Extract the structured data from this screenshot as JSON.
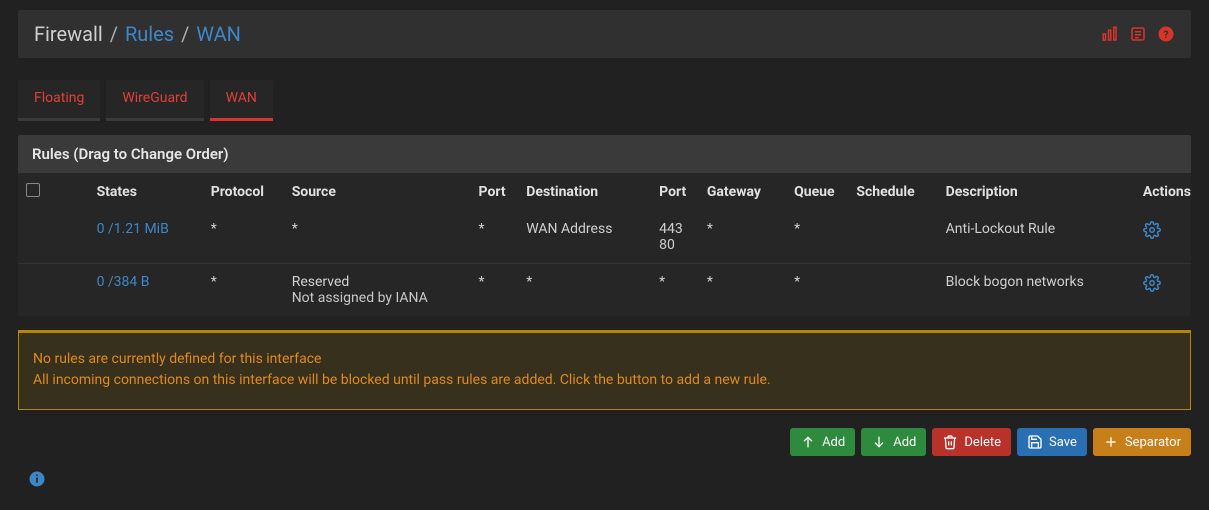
{
  "breadcrumb": {
    "root": "Firewall",
    "sep": "/",
    "mid": "Rules",
    "leaf": "WAN"
  },
  "header_icons": {
    "graph": "graph-icon",
    "log": "log-icon",
    "help": "help-icon"
  },
  "tabs": [
    {
      "label": "Floating",
      "active": false
    },
    {
      "label": "WireGuard",
      "active": false
    },
    {
      "label": "WAN",
      "active": true
    }
  ],
  "panel": {
    "title": "Rules (Drag to Change Order)"
  },
  "columns": {
    "states": "States",
    "protocol": "Protocol",
    "source": "Source",
    "sport": "Port",
    "destination": "Destination",
    "dport": "Port",
    "gateway": "Gateway",
    "queue": "Queue",
    "schedule": "Schedule",
    "description": "Description",
    "actions": "Actions"
  },
  "rows": [
    {
      "status": "pass",
      "states": "0 /1.21 MiB",
      "protocol": "*",
      "source": "*",
      "sport": "*",
      "destination": "WAN Address",
      "dport1": "443",
      "dport2": "80",
      "gateway": "*",
      "queue": "*",
      "schedule": "",
      "description": "Anti-Lockout Rule"
    },
    {
      "status": "block",
      "states": "0 /384 B",
      "protocol": "*",
      "source": "Reserved",
      "source2": "Not assigned by IANA",
      "sport": "*",
      "destination": "*",
      "dport1": "*",
      "dport2": "",
      "gateway": "*",
      "queue": "*",
      "schedule": "",
      "description": "Block bogon networks"
    }
  ],
  "warning": {
    "line1": "No rules are currently defined for this interface",
    "line2": "All incoming connections on this interface will be blocked until pass rules are added. Click the button to add a new rule."
  },
  "buttons": {
    "add_up": "Add",
    "add_down": "Add",
    "delete": "Delete",
    "save": "Save",
    "separator": "Separator"
  }
}
